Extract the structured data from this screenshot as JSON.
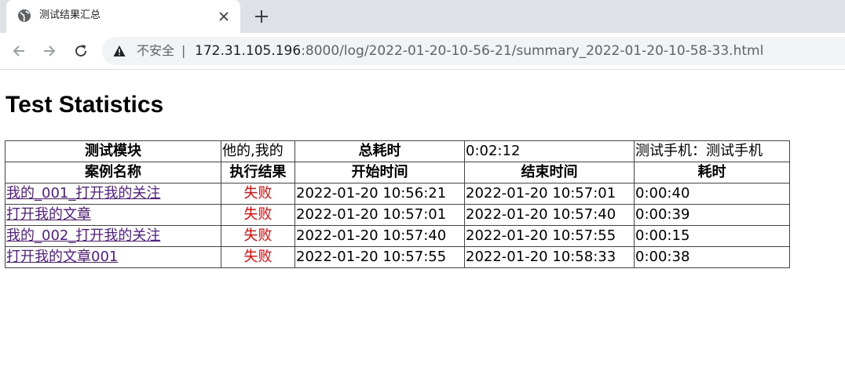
{
  "browser": {
    "tab_title": "测试结果汇总",
    "security_label": "不安全",
    "separator": "|",
    "url_host": "172.31.105.196",
    "url_rest": ":8000/log/2022-01-20-10-56-21/summary_2022-01-20-10-58-33.html",
    "icons": [
      "globe-icon",
      "close-icon",
      "plus-icon",
      "back-icon",
      "forward-icon",
      "reload-icon",
      "warning-icon"
    ]
  },
  "page": {
    "title": "Test Statistics"
  },
  "summary": {
    "module_label": "测试模块",
    "module_value": "他的,我的",
    "total_time_label": "总耗时",
    "total_time_value": "0:02:12",
    "device": "测试手机：测试手机"
  },
  "columns": [
    "案例名称",
    "执行结果",
    "开始时间",
    "结束时间",
    "耗时"
  ],
  "rows": [
    {
      "name": "我的_001_打开我的关注",
      "result": "失败",
      "start": "2022-01-20 10:56:21",
      "end": "2022-01-20 10:57:01",
      "duration": "0:00:40"
    },
    {
      "name": "打开我的文章",
      "result": "失败",
      "start": "2022-01-20 10:57:01",
      "end": "2022-01-20 10:57:40",
      "duration": "0:00:39"
    },
    {
      "name": "我的_002_打开我的关注",
      "result": "失败",
      "start": "2022-01-20 10:57:40",
      "end": "2022-01-20 10:57:55",
      "duration": "0:00:15"
    },
    {
      "name": "打开我的文章001",
      "result": "失败",
      "start": "2022-01-20 10:57:55",
      "end": "2022-01-20 10:58:33",
      "duration": "0:00:38"
    }
  ],
  "colors": {
    "fail": "#ff0000",
    "link": "#551a8b",
    "tabbar": "#dee1e6",
    "omnibox": "#f1f3f4"
  }
}
